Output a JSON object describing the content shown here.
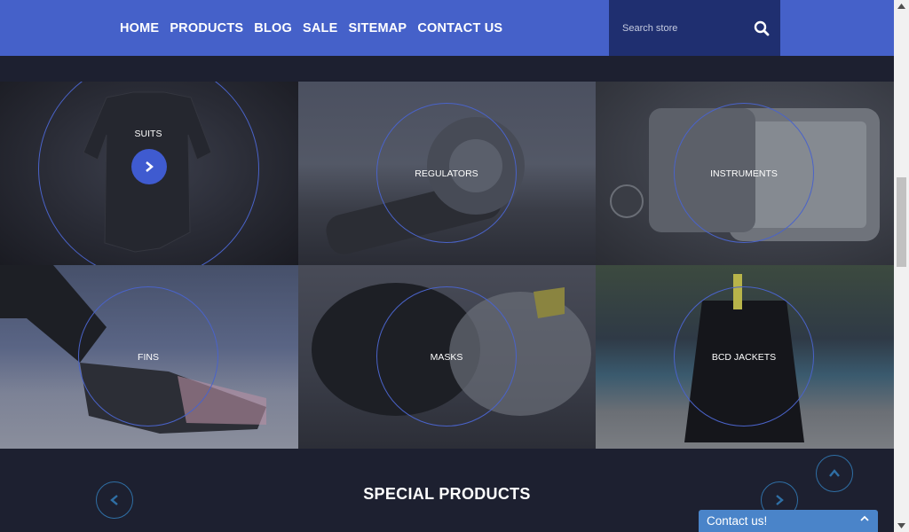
{
  "nav": {
    "items": [
      "HOME",
      "PRODUCTS",
      "BLOG",
      "SALE",
      "SITEMAP",
      "CONTACT US"
    ]
  },
  "search": {
    "placeholder": "Search store",
    "icon": "search-icon"
  },
  "categories": [
    {
      "label": "SUITS",
      "highlighted": true
    },
    {
      "label": "REGULATORS"
    },
    {
      "label": "INSTRUMENTS"
    },
    {
      "label": "FINS"
    },
    {
      "label": "MASKS"
    },
    {
      "label": "BCD JACKETS"
    }
  ],
  "special": {
    "title": "SPECIAL PRODUCTS",
    "prev_icon": "chevron-left-icon",
    "next_icon": "chevron-right-icon"
  },
  "scroll_top_icon": "chevron-up-icon",
  "contact": {
    "label": "Contact us!",
    "icon": "chevron-up-icon"
  },
  "colors": {
    "header": "#4561c9",
    "search_bg": "#1f2f70",
    "page_bg": "#1e2130",
    "accent": "#4a63c9",
    "contact_bar": "#4a84c9"
  }
}
